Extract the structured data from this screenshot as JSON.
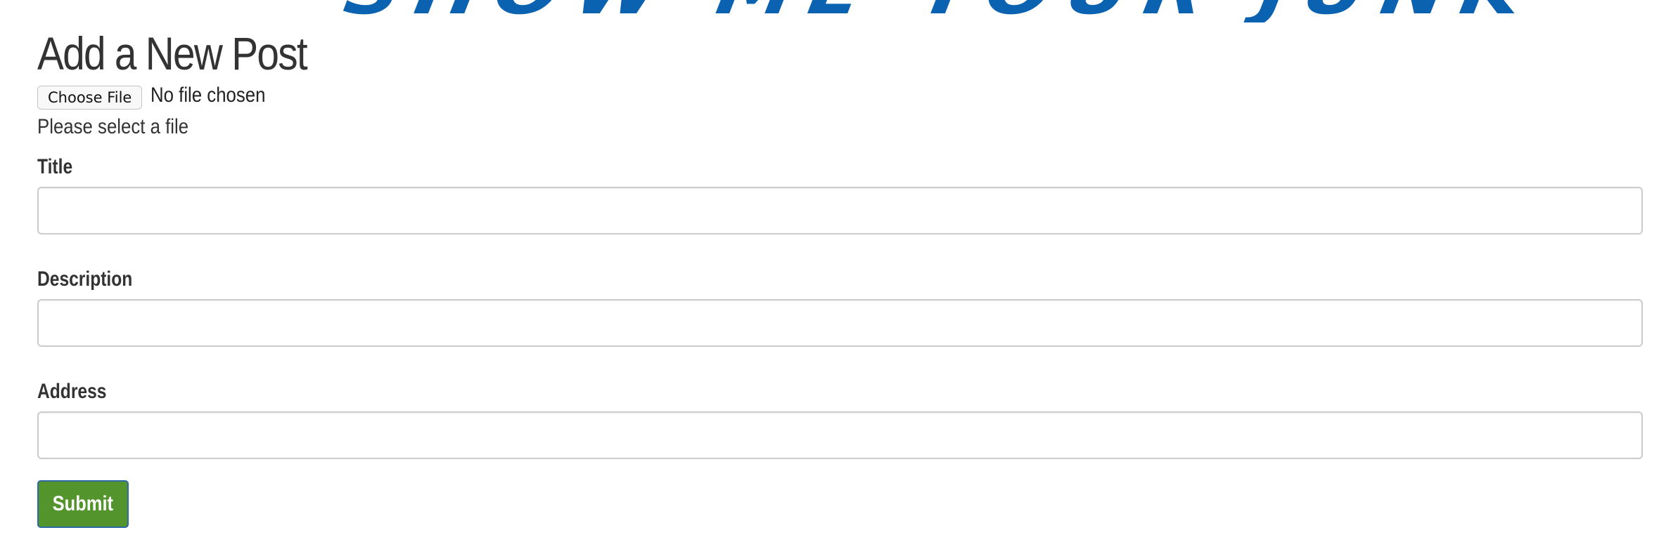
{
  "header": {
    "logo_text": "SHOW ME YOUR JUNK"
  },
  "form": {
    "title": "Add a New Post",
    "file": {
      "button_label": "Choose File",
      "status": "No file chosen",
      "help_text": "Please select a file"
    },
    "fields": {
      "title": {
        "label": "Title",
        "value": ""
      },
      "description": {
        "label": "Description",
        "value": ""
      },
      "address": {
        "label": "Address",
        "value": ""
      }
    },
    "submit_label": "Submit"
  },
  "colors": {
    "logo": "#0a62b0",
    "submit_background": "#53952c",
    "submit_border": "#2d6aa6",
    "text": "#333333",
    "input_border": "#cccccc"
  }
}
